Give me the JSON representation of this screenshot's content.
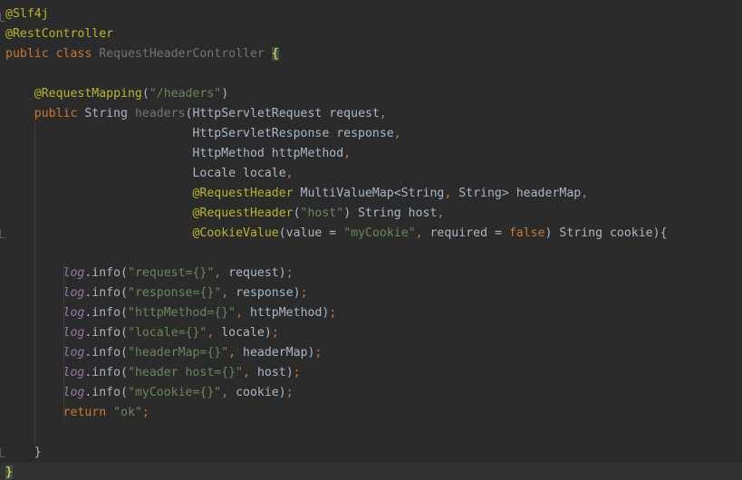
{
  "editor": {
    "lines": [
      {
        "segments": [
          {
            "text": "@Slf4j",
            "cls": "annotation"
          }
        ]
      },
      {
        "segments": [
          {
            "text": "@RestController",
            "cls": "annotation"
          }
        ]
      },
      {
        "segments": [
          {
            "text": "public",
            "cls": "keyword"
          },
          {
            "text": " ",
            "cls": "plain"
          },
          {
            "text": "class",
            "cls": "keyword"
          },
          {
            "text": " ",
            "cls": "plain"
          },
          {
            "text": "RequestHeaderController",
            "cls": "unused"
          },
          {
            "text": " ",
            "cls": "plain"
          },
          {
            "text": "{",
            "cls": "brace-hl"
          }
        ]
      },
      {
        "segments": []
      },
      {
        "segments": [
          {
            "text": "    ",
            "cls": "plain"
          },
          {
            "text": "@RequestMapping",
            "cls": "annotation"
          },
          {
            "text": "(",
            "cls": "plain"
          },
          {
            "text": "\"/headers\"",
            "cls": "string"
          },
          {
            "text": ")",
            "cls": "plain"
          }
        ]
      },
      {
        "segments": [
          {
            "text": "    ",
            "cls": "plain"
          },
          {
            "text": "public",
            "cls": "keyword"
          },
          {
            "text": " String ",
            "cls": "plain"
          },
          {
            "text": "headers",
            "cls": "unused"
          },
          {
            "text": "(HttpServletRequest request",
            "cls": "plain"
          },
          {
            "text": ",",
            "cls": "punct"
          }
        ]
      },
      {
        "segments": [
          {
            "text": "                          HttpServletResponse response",
            "cls": "plain"
          },
          {
            "text": ",",
            "cls": "punct"
          }
        ]
      },
      {
        "segments": [
          {
            "text": "                          HttpMethod httpMethod",
            "cls": "plain"
          },
          {
            "text": ",",
            "cls": "punct"
          }
        ]
      },
      {
        "segments": [
          {
            "text": "                          Locale locale",
            "cls": "plain"
          },
          {
            "text": ",",
            "cls": "punct"
          }
        ]
      },
      {
        "segments": [
          {
            "text": "                          ",
            "cls": "plain"
          },
          {
            "text": "@RequestHeader",
            "cls": "annotation"
          },
          {
            "text": " MultiValueMap<String",
            "cls": "plain"
          },
          {
            "text": ",",
            "cls": "punct"
          },
          {
            "text": " String> headerMap",
            "cls": "plain"
          },
          {
            "text": ",",
            "cls": "punct"
          }
        ]
      },
      {
        "segments": [
          {
            "text": "                          ",
            "cls": "plain"
          },
          {
            "text": "@RequestHeader",
            "cls": "annotation"
          },
          {
            "text": "(",
            "cls": "plain"
          },
          {
            "text": "\"host\"",
            "cls": "string"
          },
          {
            "text": ") String host",
            "cls": "plain"
          },
          {
            "text": ",",
            "cls": "punct"
          }
        ]
      },
      {
        "segments": [
          {
            "text": "                          ",
            "cls": "plain"
          },
          {
            "text": "@CookieValue",
            "cls": "annotation"
          },
          {
            "text": "(value = ",
            "cls": "plain"
          },
          {
            "text": "\"myCookie\"",
            "cls": "string"
          },
          {
            "text": ",",
            "cls": "punct"
          },
          {
            "text": " required = ",
            "cls": "plain"
          },
          {
            "text": "false",
            "cls": "keyword"
          },
          {
            "text": ") String cookie){",
            "cls": "plain"
          }
        ]
      },
      {
        "segments": []
      },
      {
        "segments": [
          {
            "text": "        ",
            "cls": "plain"
          },
          {
            "text": "log",
            "cls": "field"
          },
          {
            "text": ".info(",
            "cls": "plain"
          },
          {
            "text": "\"request={}\"",
            "cls": "string"
          },
          {
            "text": ",",
            "cls": "punct"
          },
          {
            "text": " request)",
            "cls": "plain"
          },
          {
            "text": ";",
            "cls": "punct"
          }
        ]
      },
      {
        "segments": [
          {
            "text": "        ",
            "cls": "plain"
          },
          {
            "text": "log",
            "cls": "field"
          },
          {
            "text": ".info(",
            "cls": "plain"
          },
          {
            "text": "\"response={}\"",
            "cls": "string"
          },
          {
            "text": ",",
            "cls": "punct"
          },
          {
            "text": " response)",
            "cls": "plain"
          },
          {
            "text": ";",
            "cls": "punct"
          }
        ]
      },
      {
        "segments": [
          {
            "text": "        ",
            "cls": "plain"
          },
          {
            "text": "log",
            "cls": "field"
          },
          {
            "text": ".info(",
            "cls": "plain"
          },
          {
            "text": "\"httpMethod={}\"",
            "cls": "string"
          },
          {
            "text": ",",
            "cls": "punct"
          },
          {
            "text": " httpMethod)",
            "cls": "plain"
          },
          {
            "text": ";",
            "cls": "punct"
          }
        ]
      },
      {
        "segments": [
          {
            "text": "        ",
            "cls": "plain"
          },
          {
            "text": "log",
            "cls": "field"
          },
          {
            "text": ".info(",
            "cls": "plain"
          },
          {
            "text": "\"locale={}\"",
            "cls": "string"
          },
          {
            "text": ",",
            "cls": "punct"
          },
          {
            "text": " locale)",
            "cls": "plain"
          },
          {
            "text": ";",
            "cls": "punct"
          }
        ]
      },
      {
        "segments": [
          {
            "text": "        ",
            "cls": "plain"
          },
          {
            "text": "log",
            "cls": "field"
          },
          {
            "text": ".info(",
            "cls": "plain"
          },
          {
            "text": "\"headerMap={}\"",
            "cls": "string"
          },
          {
            "text": ",",
            "cls": "punct"
          },
          {
            "text": " headerMap)",
            "cls": "plain"
          },
          {
            "text": ";",
            "cls": "punct"
          }
        ]
      },
      {
        "segments": [
          {
            "text": "        ",
            "cls": "plain"
          },
          {
            "text": "log",
            "cls": "field"
          },
          {
            "text": ".info(",
            "cls": "plain"
          },
          {
            "text": "\"header host={}\"",
            "cls": "string"
          },
          {
            "text": ",",
            "cls": "punct"
          },
          {
            "text": " host)",
            "cls": "plain"
          },
          {
            "text": ";",
            "cls": "punct"
          }
        ]
      },
      {
        "segments": [
          {
            "text": "        ",
            "cls": "plain"
          },
          {
            "text": "log",
            "cls": "field"
          },
          {
            "text": ".info(",
            "cls": "plain"
          },
          {
            "text": "\"myCookie={}\"",
            "cls": "string"
          },
          {
            "text": ",",
            "cls": "punct"
          },
          {
            "text": " cookie)",
            "cls": "plain"
          },
          {
            "text": ";",
            "cls": "punct"
          }
        ]
      },
      {
        "segments": [
          {
            "text": "        ",
            "cls": "plain"
          },
          {
            "text": "return",
            "cls": "keyword"
          },
          {
            "text": " ",
            "cls": "plain"
          },
          {
            "text": "\"ok\"",
            "cls": "string"
          },
          {
            "text": ";",
            "cls": "punct"
          }
        ]
      },
      {
        "segments": []
      },
      {
        "segments": [
          {
            "text": "    }",
            "cls": "plain"
          }
        ]
      },
      {
        "segments": [
          {
            "text": "}",
            "cls": "brace-hl"
          }
        ]
      }
    ]
  }
}
